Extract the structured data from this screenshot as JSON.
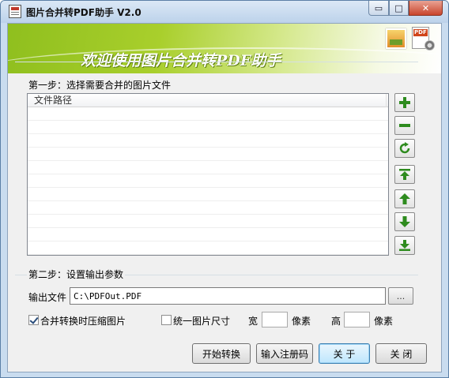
{
  "window": {
    "title": "图片合并转PDF助手 V2.0",
    "controls": {
      "minimize": "▭",
      "maximize": "□",
      "close": "✕"
    }
  },
  "banner": {
    "welcome_text": "欢迎使用图片合并转PDF助手",
    "pdf_icon_label": "PDF",
    "colors": {
      "start": "#8fbf1e",
      "end": "#ffffff",
      "text": "#ffffff"
    }
  },
  "step1": {
    "title": "第一步：选择需要合并的图片文件",
    "list": {
      "columns": [
        "文件路径"
      ],
      "rows": []
    },
    "side_buttons": [
      {
        "name": "add",
        "icon": "plus-icon"
      },
      {
        "name": "remove",
        "icon": "minus-icon"
      },
      {
        "name": "clear",
        "icon": "refresh-icon"
      },
      {
        "name": "move-top",
        "icon": "move-top-icon"
      },
      {
        "name": "move-up",
        "icon": "arrow-up-icon"
      },
      {
        "name": "move-down",
        "icon": "arrow-down-icon"
      },
      {
        "name": "move-bottom",
        "icon": "move-bottom-icon"
      }
    ]
  },
  "step2": {
    "title": "第二步：设置输出参数",
    "output_label": "输出文件",
    "output_value": "C:\\PDFOut.PDF",
    "browse_label": "...",
    "compress_label": "合并转换时压缩图片",
    "compress_checked": true,
    "unify_label": "统一图片尺寸",
    "unify_checked": false,
    "width_label": "宽",
    "width_value": "",
    "width_unit": "像素",
    "height_label": "高",
    "height_value": "",
    "height_unit": "像素"
  },
  "buttons": {
    "start": "开始转换",
    "register": "输入注册码",
    "about": "关 于",
    "close": "关 闭"
  },
  "colors": {
    "accent_green": "#2e8b1e",
    "frame": "#c9dcef"
  }
}
